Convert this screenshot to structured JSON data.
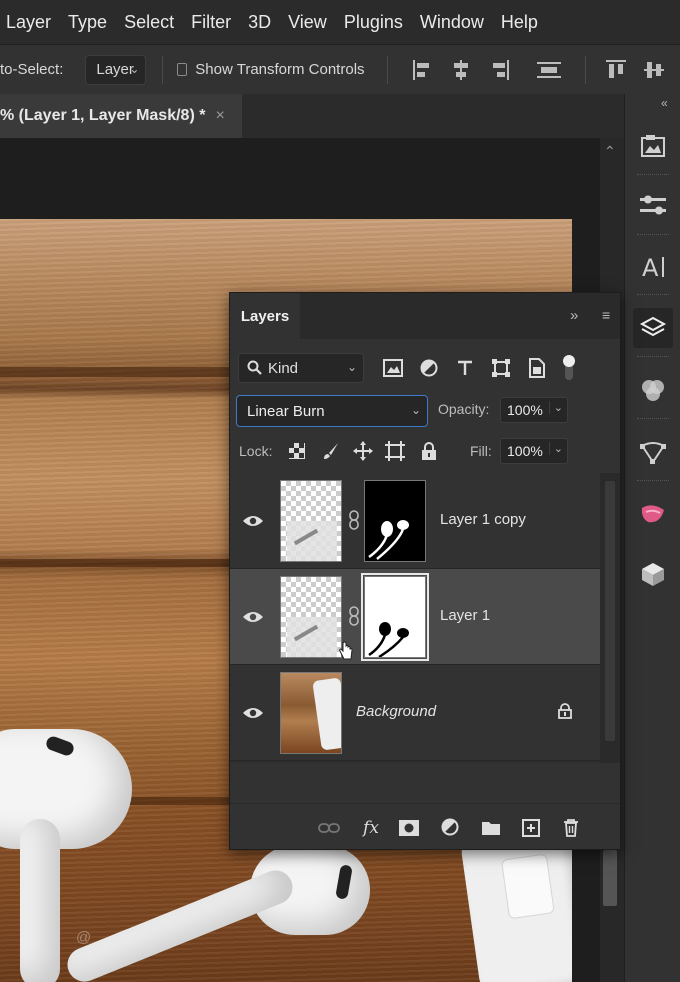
{
  "menu": [
    "Layer",
    "Type",
    "Select",
    "Filter",
    "3D",
    "View",
    "Plugins",
    "Window",
    "Help"
  ],
  "options": {
    "auto_select_label": "to-Select:",
    "auto_select_value": "Layer",
    "transform_label": "Show Transform Controls"
  },
  "document_tab": {
    "title": "% (Layer 1, Layer Mask/8) *",
    "close": "×"
  },
  "layers_panel": {
    "title": "Layers",
    "expand_icon": "»",
    "menu_icon": "≡",
    "kind_label": "Kind",
    "blend_mode": "Linear Burn",
    "opacity_label": "Opacity:",
    "opacity_value": "100%",
    "lock_label": "Lock:",
    "fill_label": "Fill:",
    "fill_value": "100%",
    "layers": [
      {
        "name": "Layer 1 copy",
        "visible": true,
        "selected": false,
        "has_mask": true,
        "mask": "black",
        "locked": false
      },
      {
        "name": "Layer 1",
        "visible": true,
        "selected": true,
        "has_mask": true,
        "mask": "white",
        "locked": false
      },
      {
        "name": "Background",
        "visible": true,
        "selected": false,
        "has_mask": false,
        "locked": true
      }
    ]
  },
  "canvas": {
    "watermark": "@"
  },
  "colors": {
    "accent": "#3f7ac8",
    "panel": "#323232",
    "selected_row": "#4a4a4a"
  }
}
